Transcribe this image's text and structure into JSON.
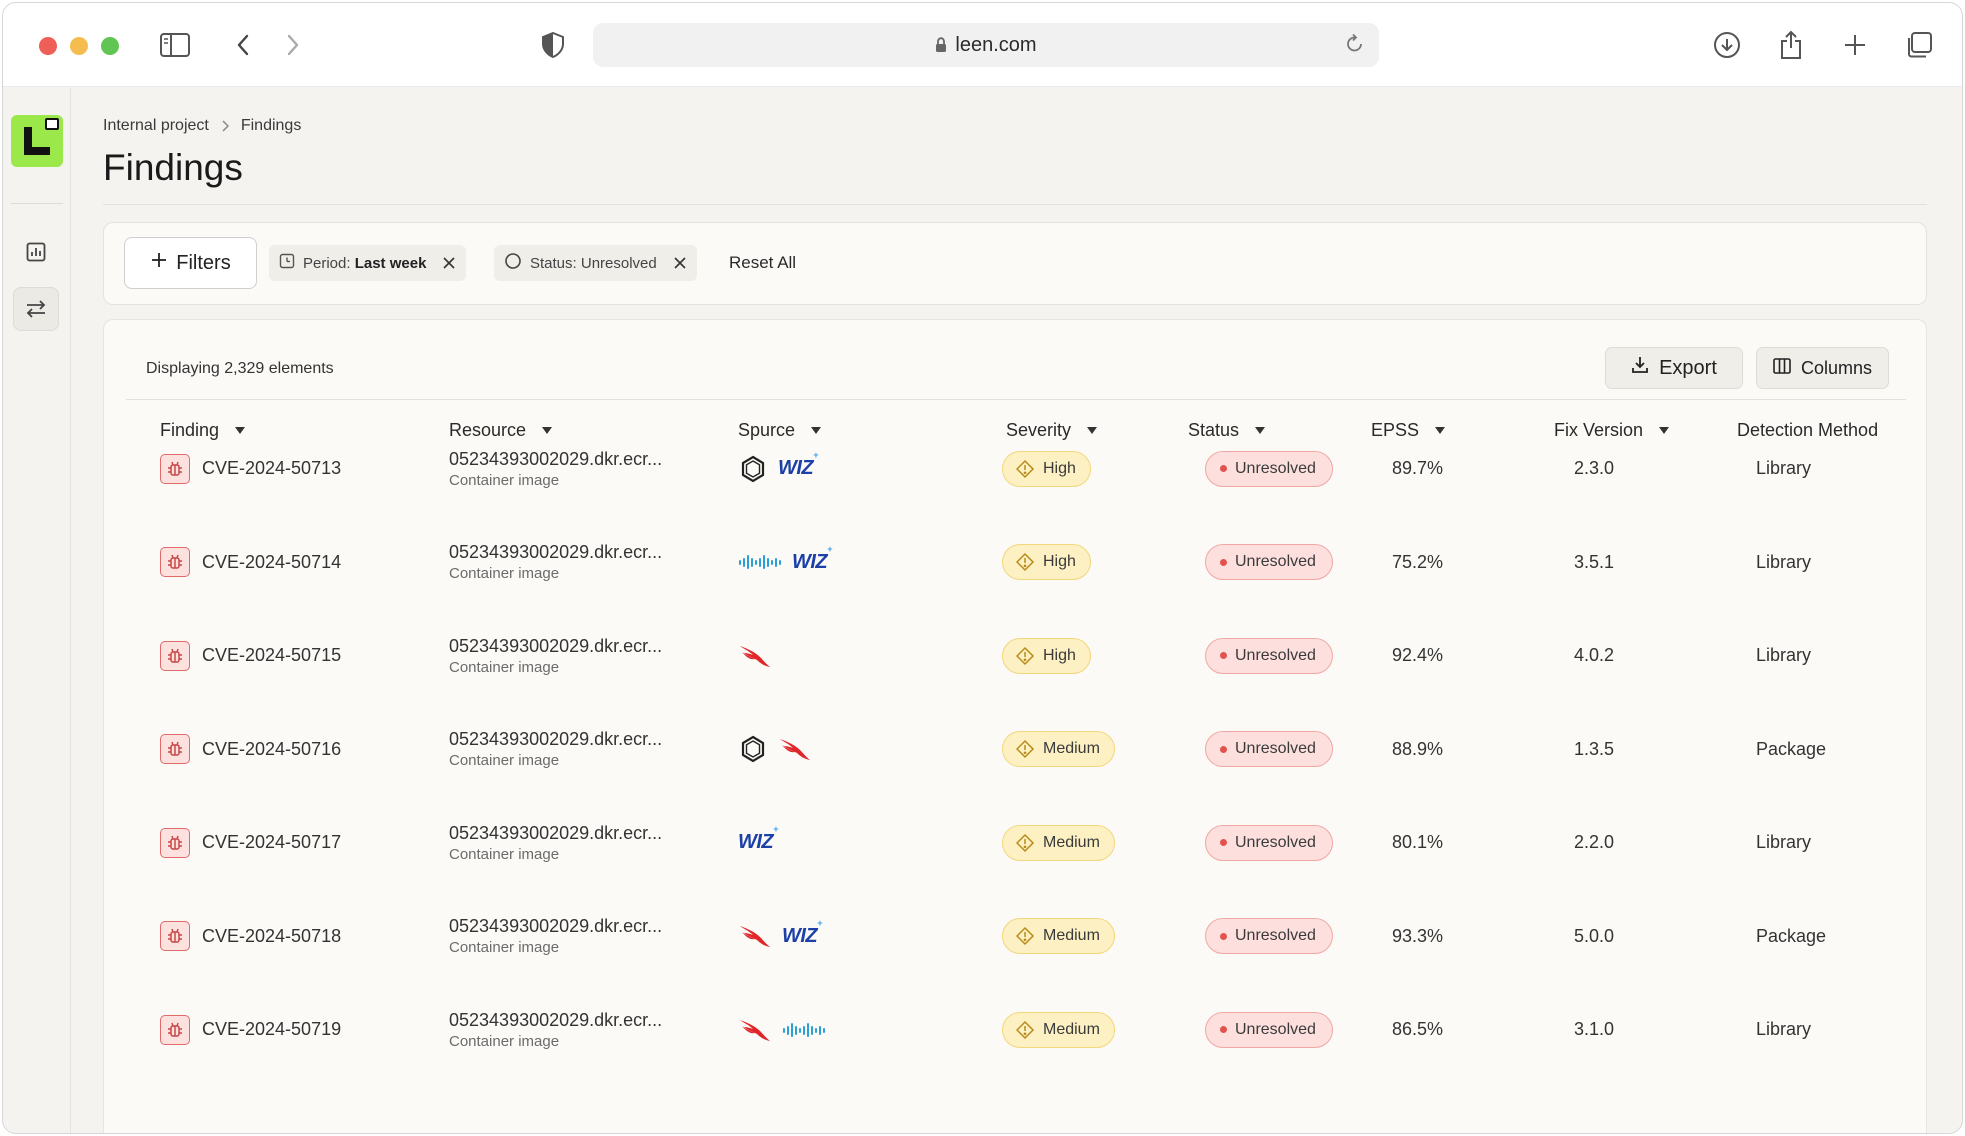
{
  "browser": {
    "url": "leen.com"
  },
  "breadcrumb": {
    "parent": "Internal project",
    "current": "Findings"
  },
  "page": {
    "title": "Findings"
  },
  "filters": {
    "filters_button": "Filters",
    "period_label": "Period:",
    "period_value": "Last week",
    "status_label": "Status:",
    "status_value": "Unresolved",
    "reset_all": "Reset All"
  },
  "table": {
    "count_text": "Displaying 2,329 elements",
    "export_label": "Export",
    "columns_label": "Columns",
    "headers": {
      "finding": "Finding",
      "resource": "Resource",
      "source": "Spurce",
      "severity": "Severity",
      "status": "Status",
      "epss": "EPSS",
      "fix_version": "Fix Version",
      "detection_method": "Detection Method"
    },
    "rows": [
      {
        "finding": "CVE-2024-50713",
        "resource": "05234393002029.dkr.ecr...",
        "resource_type": "Container image",
        "sources": [
          "openai-icon",
          "wiz-logo"
        ],
        "severity": "High",
        "status": "Unresolved",
        "epss": "89.7%",
        "fix_version": "2.3.0",
        "detection": "Library"
      },
      {
        "finding": "CVE-2024-50714",
        "resource": "05234393002029.dkr.ecr...",
        "resource_type": "Container image",
        "sources": [
          "cisco-icon",
          "wiz-logo"
        ],
        "severity": "High",
        "status": "Unresolved",
        "epss": "75.2%",
        "fix_version": "3.5.1",
        "detection": "Library"
      },
      {
        "finding": "CVE-2024-50715",
        "resource": "05234393002029.dkr.ecr...",
        "resource_type": "Container image",
        "sources": [
          "crowdstrike-icon"
        ],
        "severity": "High",
        "status": "Unresolved",
        "epss": "92.4%",
        "fix_version": "4.0.2",
        "detection": "Library"
      },
      {
        "finding": "CVE-2024-50716",
        "resource": "05234393002029.dkr.ecr...",
        "resource_type": "Container image",
        "sources": [
          "openai-icon",
          "crowdstrike-icon"
        ],
        "severity": "Medium",
        "status": "Unresolved",
        "epss": "88.9%",
        "fix_version": "1.3.5",
        "detection": "Package"
      },
      {
        "finding": "CVE-2024-50717",
        "resource": "05234393002029.dkr.ecr...",
        "resource_type": "Container image",
        "sources": [
          "wiz-logo"
        ],
        "severity": "Medium",
        "status": "Unresolved",
        "epss": "80.1%",
        "fix_version": "2.2.0",
        "detection": "Library"
      },
      {
        "finding": "CVE-2024-50718",
        "resource": "05234393002029.dkr.ecr...",
        "resource_type": "Container image",
        "sources": [
          "crowdstrike-icon",
          "wiz-logo"
        ],
        "severity": "Medium",
        "status": "Unresolved",
        "epss": "93.3%",
        "fix_version": "5.0.0",
        "detection": "Package"
      },
      {
        "finding": "CVE-2024-50719",
        "resource": "05234393002029.dkr.ecr...",
        "resource_type": "Container image",
        "sources": [
          "crowdstrike-icon",
          "cisco-icon"
        ],
        "severity": "Medium",
        "status": "Unresolved",
        "epss": "86.5%",
        "fix_version": "3.1.0",
        "detection": "Library"
      }
    ]
  },
  "colors": {
    "brand_logo": "#9be84b",
    "severity_bg": "#fdf0c3",
    "status_bg": "#fde0de",
    "status_dot": "#e2534f",
    "bug_border": "#e0696a",
    "wiz_blue": "#1c3fa8",
    "crowdstrike_red": "#e0262b",
    "cisco_blue": "#2aa0d8"
  }
}
